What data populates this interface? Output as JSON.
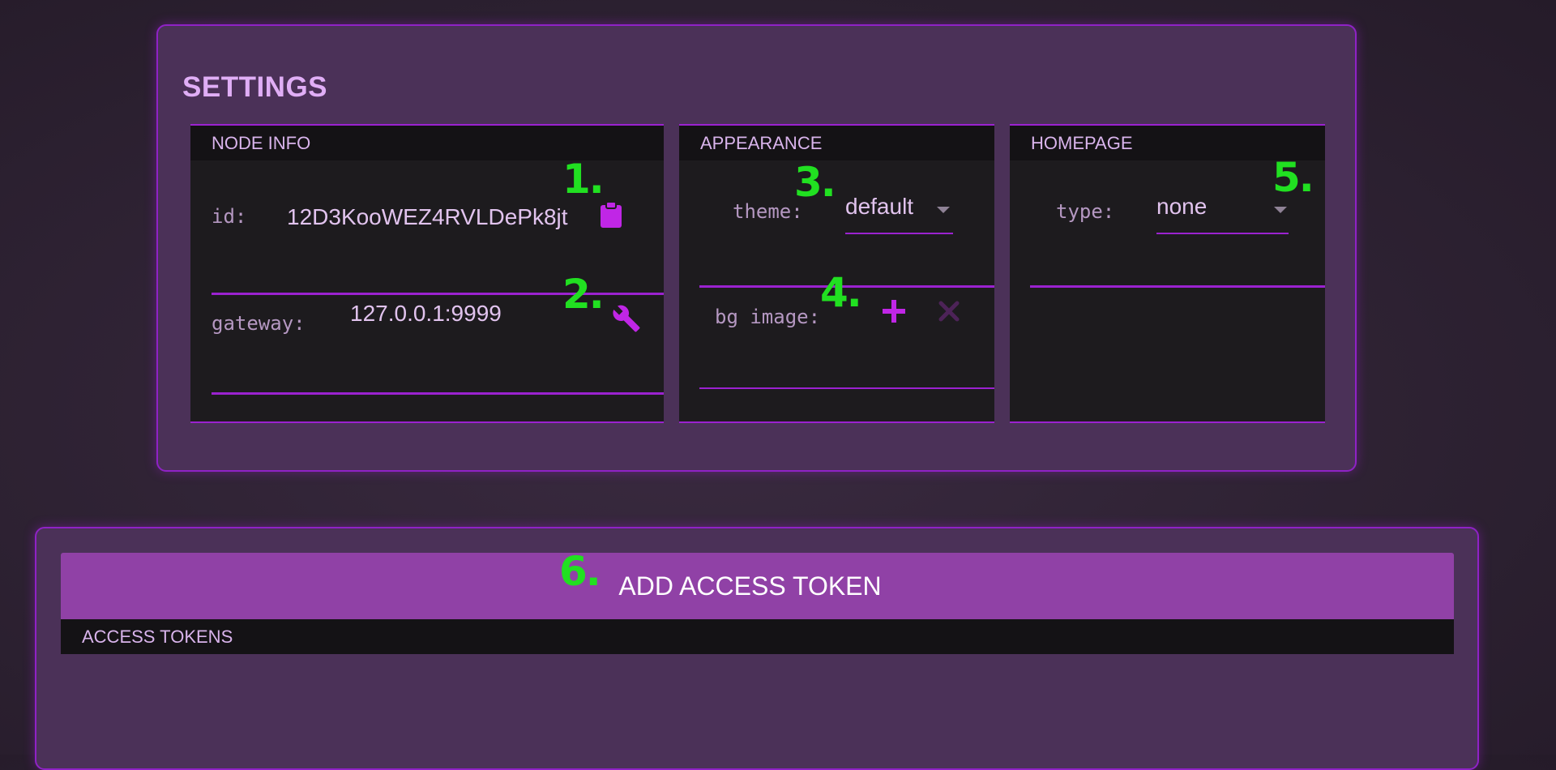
{
  "settings": {
    "title": "SETTINGS",
    "node_info": {
      "header": "NODE INFO",
      "id_label": "id:",
      "id_value": "12D3KooWEZ4RVLDePk8jt",
      "gateway_label": "gateway:",
      "gateway_value": "127.0.0.1:9999",
      "copy_icon": "clipboard-icon",
      "gateway_icon": "wrench-icon"
    },
    "appearance": {
      "header": "APPEARANCE",
      "theme_label": "theme:",
      "theme_value": "default",
      "bg_label": "bg image:",
      "add_icon": "plus-icon",
      "clear_icon": "close-icon"
    },
    "homepage": {
      "header": "HOMEPAGE",
      "type_label": "type:",
      "type_value": "none"
    }
  },
  "tokens": {
    "add_button": "ADD ACCESS TOKEN",
    "header": "ACCESS TOKENS"
  },
  "annotations": [
    "1.",
    "2.",
    "3.",
    "4.",
    "5.",
    "6."
  ],
  "colors": {
    "accent": "#9b22d0",
    "icon": "#c026e6",
    "panel": "#4b3158",
    "card": "#1d1b1e",
    "button": "#9041a6",
    "marker": "#21e021"
  }
}
